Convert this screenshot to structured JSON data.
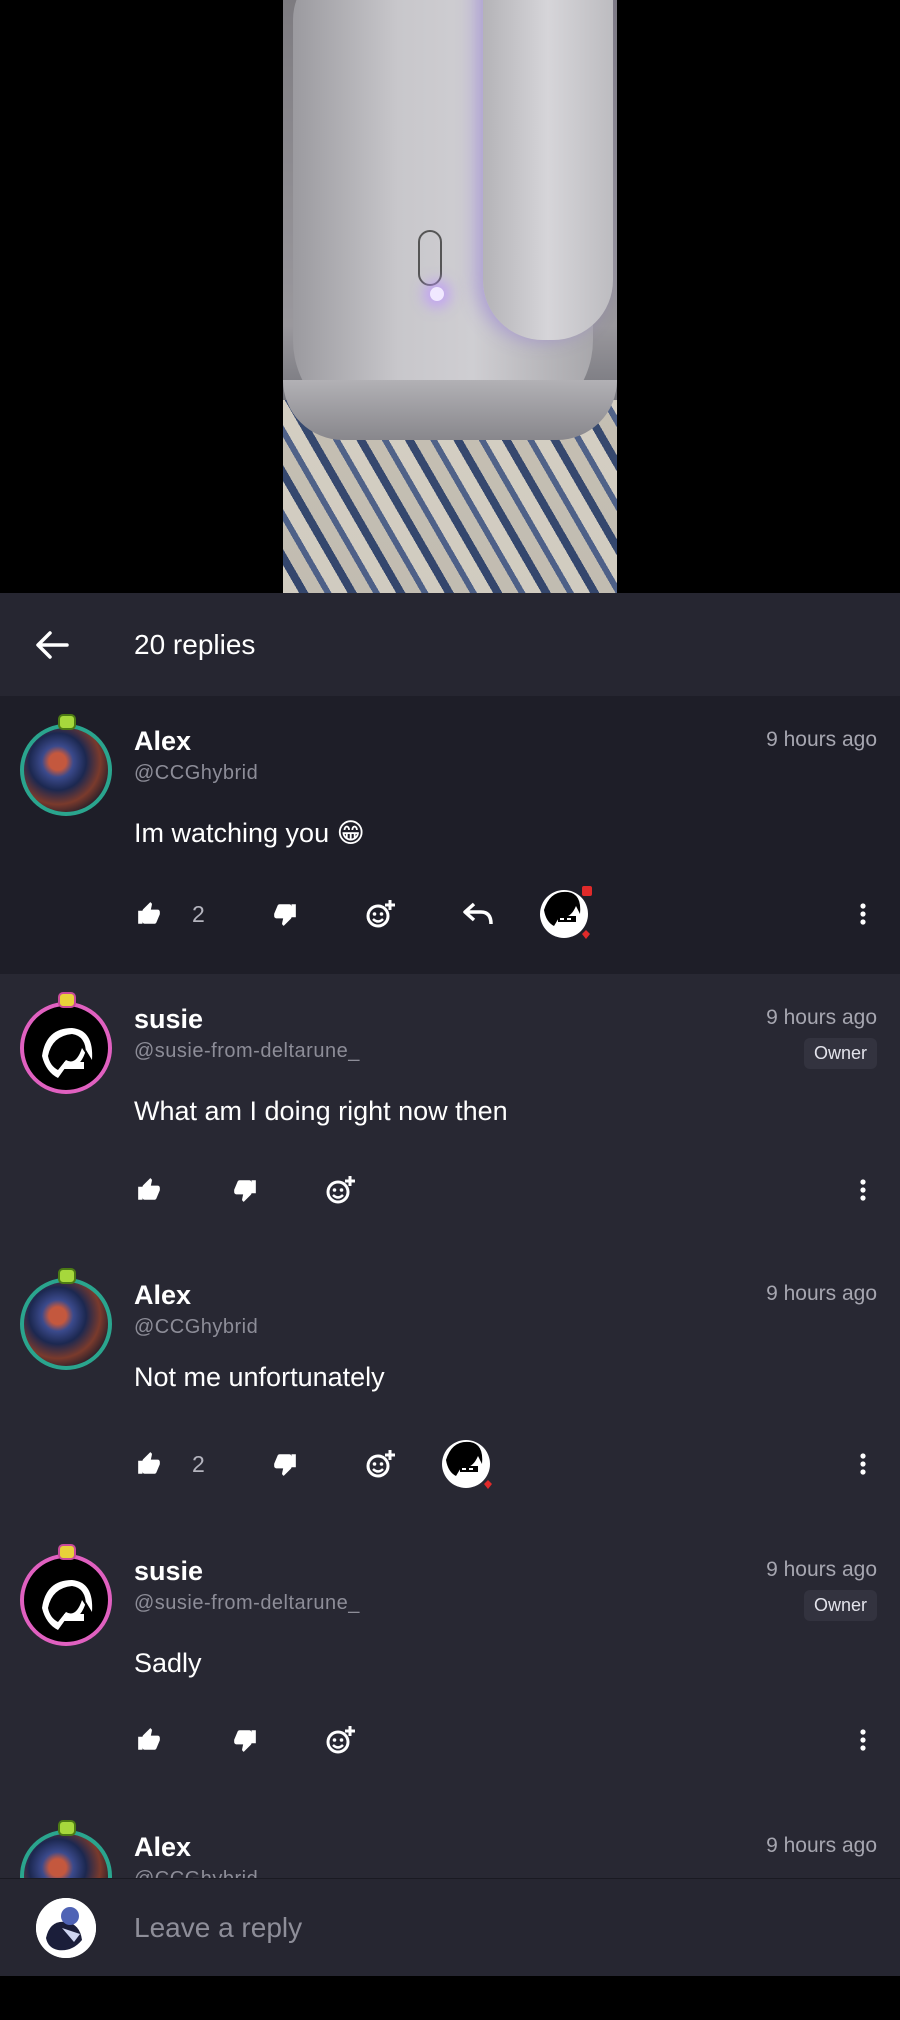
{
  "header": {
    "title": "20 replies"
  },
  "comments": [
    {
      "name": "Alex",
      "handle": "@CCGhybrid",
      "time": "9 hours ago",
      "text": "Im watching you 😁",
      "likes": "2",
      "owner": "",
      "has_creator_heart": true,
      "has_reply": true
    },
    {
      "name": "susie",
      "handle": "@susie-from-deltarune_",
      "time": "9 hours ago",
      "text": "What am I doing right now then",
      "likes": "",
      "owner": "Owner",
      "has_creator_heart": false,
      "has_reply": false
    },
    {
      "name": "Alex",
      "handle": "@CCGhybrid",
      "time": "9 hours ago",
      "text": "Not me unfortunately",
      "likes": "2",
      "owner": "",
      "has_creator_heart": true,
      "has_reply": false
    },
    {
      "name": "susie",
      "handle": "@susie-from-deltarune_",
      "time": "9 hours ago",
      "text": "Sadly",
      "likes": "",
      "owner": "Owner",
      "has_creator_heart": false,
      "has_reply": false
    },
    {
      "name": "Alex",
      "handle": "@CCGhybrid",
      "time": "9 hours ago"
    }
  ],
  "reply_bar": {
    "placeholder": "Leave a reply"
  },
  "colors": {
    "panel": "#282833",
    "header": "#262631",
    "accent_ring_alex": "#2aa58e",
    "accent_ring_susie": "#e060c0"
  },
  "icons": [
    "back-arrow-icon",
    "thumb-up-icon",
    "thumb-down-icon",
    "add-reaction-icon",
    "reply-icon",
    "more-vert-icon"
  ]
}
